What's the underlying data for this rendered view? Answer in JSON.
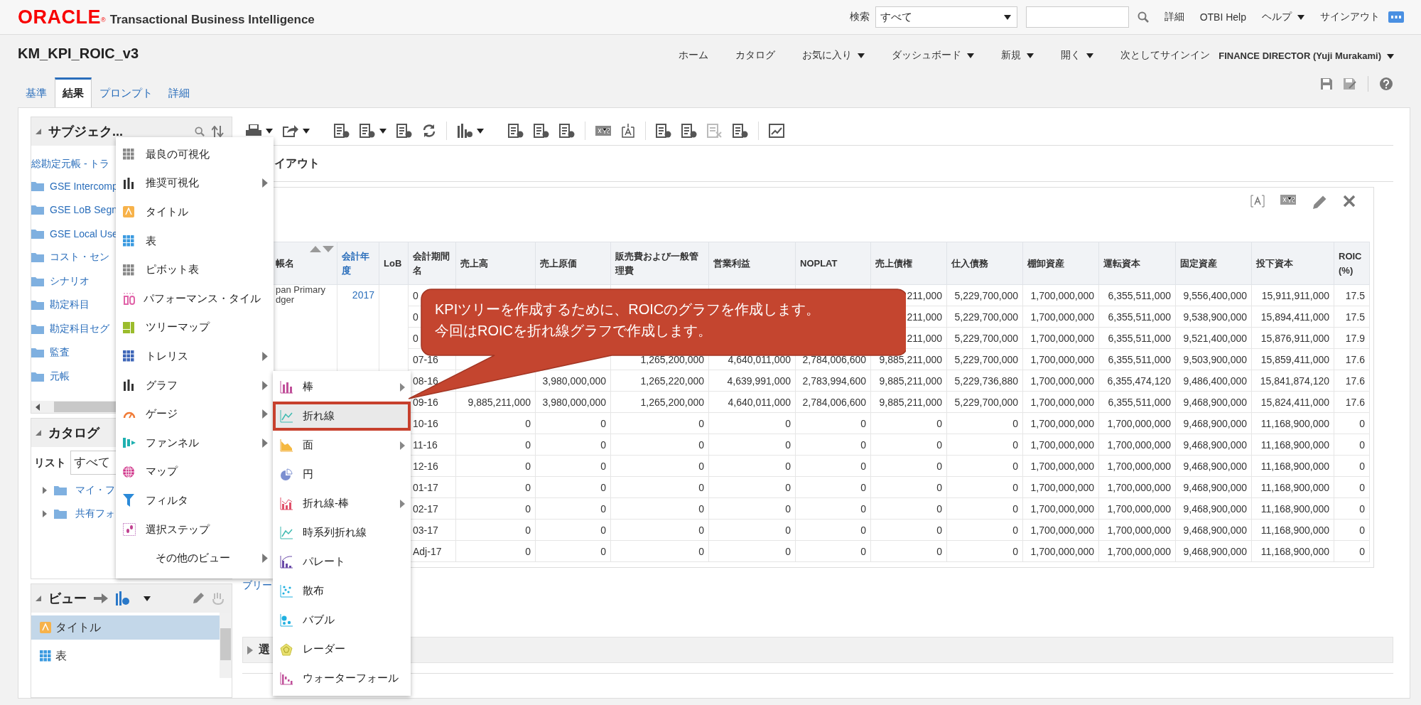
{
  "header": {
    "brand": "ORACLE",
    "brand_mark": "®",
    "product": "Transactional Business Intelligence",
    "search_label": "検索",
    "search_scope": "すべて",
    "links": [
      {
        "label": "詳細",
        "dropdown": false
      },
      {
        "label": "OTBI Help",
        "dropdown": false
      },
      {
        "label": "ヘルプ",
        "dropdown": true
      },
      {
        "label": "サインアウト",
        "dropdown": false
      }
    ]
  },
  "title": "KM_KPI_ROIC_v3",
  "nav": [
    {
      "label": "ホーム",
      "dropdown": false
    },
    {
      "label": "カタログ",
      "dropdown": false
    },
    {
      "label": "お気に入り",
      "dropdown": true
    },
    {
      "label": "ダッシュボード",
      "dropdown": true
    },
    {
      "label": "新規",
      "dropdown": true
    },
    {
      "label": "開く",
      "dropdown": true
    }
  ],
  "signed_in": {
    "label": "次としてサインイン",
    "user": "FINANCE DIRECTOR (Yuji Murakami)"
  },
  "tabs": [
    {
      "label": "基準",
      "selected": false
    },
    {
      "label": "結果",
      "selected": true
    },
    {
      "label": "プロンプト",
      "selected": false
    },
    {
      "label": "詳細",
      "selected": false
    }
  ],
  "subject_areas": {
    "title": "サブジェク...",
    "root": "総勘定元帳 - トラ",
    "folders": [
      "GSE Intercomp",
      "GSE LoB Segn",
      "GSE Local Use",
      "コスト・セン",
      "シナリオ",
      "勘定科目",
      "勘定科目セグ",
      "監査",
      "元帳"
    ]
  },
  "catalog": {
    "title": "カタログ",
    "list_label": "リスト",
    "list_value": "すべて",
    "folders": [
      {
        "label": "マイ・フ",
        "expanded": false
      },
      {
        "label": "共有フォ",
        "expanded": false
      }
    ]
  },
  "views": {
    "title": "ビュー",
    "items": [
      {
        "label": "タイトル",
        "selected": true
      },
      {
        "label": "表",
        "selected": false
      }
    ]
  },
  "layout_title": "イアウト",
  "table": {
    "columns": [
      {
        "label": "帳名",
        "link": false,
        "sortable": true
      },
      {
        "label": "会計年度",
        "link": true,
        "sortable": false
      },
      {
        "label": "LoB",
        "link": false,
        "sortable": false
      },
      {
        "label": "会計期間名",
        "link": false,
        "sortable": false
      },
      {
        "label": "売上高",
        "link": false,
        "sortable": false
      },
      {
        "label": "売上原価",
        "link": false,
        "sortable": false
      },
      {
        "label": "販売費および一般管理費",
        "link": false,
        "sortable": false
      },
      {
        "label": "営業利益",
        "link": false,
        "sortable": false
      },
      {
        "label": "NOPLAT",
        "link": false,
        "sortable": false
      },
      {
        "label": "売上債権",
        "link": false,
        "sortable": false
      },
      {
        "label": "仕入債務",
        "link": false,
        "sortable": false
      },
      {
        "label": "棚卸資産",
        "link": false,
        "sortable": false
      },
      {
        "label": "運転資本",
        "link": false,
        "sortable": false
      },
      {
        "label": "固定資産",
        "link": false,
        "sortable": false
      },
      {
        "label": "投下資本",
        "link": false,
        "sortable": false
      },
      {
        "label": "ROIC (%)",
        "link": false,
        "sortable": false
      }
    ],
    "rows": [
      [
        "pan Primary dger",
        "2017",
        "",
        "0",
        null,
        null,
        null,
        null,
        null,
        "211,000",
        "5,229,700,000",
        "1,700,000,000",
        "6,355,511,000",
        "9,556,400,000",
        "15,911,911,000",
        "17.5"
      ],
      [
        null,
        null,
        null,
        "0",
        null,
        null,
        null,
        null,
        null,
        "211,000",
        "5,229,700,000",
        "1,700,000,000",
        "6,355,511,000",
        "9,538,900,000",
        "15,894,411,000",
        "17.5"
      ],
      [
        null,
        null,
        null,
        "0",
        null,
        null,
        null,
        null,
        null,
        "211,000",
        "5,229,700,000",
        "1,700,000,000",
        "6,355,511,000",
        "9,521,400,000",
        "15,876,911,000",
        "17.9"
      ],
      [
        null,
        null,
        null,
        "07-16",
        null,
        null,
        "1,265,200,000",
        "4,640,011,000",
        "2,784,006,600",
        "9,885,211,000",
        "5,229,700,000",
        "1,700,000,000",
        "6,355,511,000",
        "9,503,900,000",
        "15,859,411,000",
        "17.6"
      ],
      [
        null,
        null,
        null,
        "08-16",
        null,
        "3,980,000,000",
        "1,265,220,000",
        "4,639,991,000",
        "2,783,994,600",
        "9,885,211,000",
        "5,229,736,880",
        "1,700,000,000",
        "6,355,474,120",
        "9,486,400,000",
        "15,841,874,120",
        "17.6"
      ],
      [
        null,
        null,
        null,
        "09-16",
        "9,885,211,000",
        "3,980,000,000",
        "1,265,200,000",
        "4,640,011,000",
        "2,784,006,600",
        "9,885,211,000",
        "5,229,700,000",
        "1,700,000,000",
        "6,355,511,000",
        "9,468,900,000",
        "15,824,411,000",
        "17.6"
      ],
      [
        null,
        null,
        null,
        "10-16",
        "0",
        "0",
        "0",
        "0",
        "0",
        "0",
        "0",
        "1,700,000,000",
        "1,700,000,000",
        "9,468,900,000",
        "11,168,900,000",
        "0"
      ],
      [
        null,
        null,
        null,
        "11-16",
        "0",
        "0",
        "0",
        "0",
        "0",
        "0",
        "0",
        "1,700,000,000",
        "1,700,000,000",
        "9,468,900,000",
        "11,168,900,000",
        "0"
      ],
      [
        null,
        null,
        null,
        "12-16",
        "0",
        "0",
        "0",
        "0",
        "0",
        "0",
        "0",
        "1,700,000,000",
        "1,700,000,000",
        "9,468,900,000",
        "11,168,900,000",
        "0"
      ],
      [
        null,
        null,
        null,
        "01-17",
        "0",
        "0",
        "0",
        "0",
        "0",
        "0",
        "0",
        "1,700,000,000",
        "1,700,000,000",
        "9,468,900,000",
        "11,168,900,000",
        "0"
      ],
      [
        null,
        null,
        null,
        "02-17",
        "0",
        "0",
        "0",
        "0",
        "0",
        "0",
        "0",
        "1,700,000,000",
        "1,700,000,000",
        "9,468,900,000",
        "11,168,900,000",
        "0"
      ],
      [
        null,
        null,
        null,
        "03-17",
        "0",
        "0",
        "0",
        "0",
        "0",
        "0",
        "0",
        "1,700,000,000",
        "1,700,000,000",
        "9,468,900,000",
        "11,168,900,000",
        "0"
      ],
      [
        null,
        null,
        null,
        "Adj-17",
        "0",
        "0",
        "0",
        "0",
        "0",
        "0",
        "0",
        "1,700,000,000",
        "1,700,000,000",
        "9,468,900,000",
        "11,168,900,000",
        "0"
      ]
    ]
  },
  "link_below": "ブリー",
  "section_title": "選",
  "menu": [
    {
      "label": "最良の可視化",
      "has_submenu": false
    },
    {
      "label": "推奨可視化",
      "has_submenu": true
    },
    {
      "label": "タイトル",
      "has_submenu": false
    },
    {
      "label": "表",
      "has_submenu": false
    },
    {
      "label": "ピボット表",
      "has_submenu": false
    },
    {
      "label": "パフォーマンス・タイル",
      "has_submenu": false
    },
    {
      "label": "ツリーマップ",
      "has_submenu": false
    },
    {
      "label": "トレリス",
      "has_submenu": true
    },
    {
      "label": "グラフ",
      "has_submenu": true
    },
    {
      "label": "ゲージ",
      "has_submenu": true
    },
    {
      "label": "ファンネル",
      "has_submenu": true
    },
    {
      "label": "マップ",
      "has_submenu": false
    },
    {
      "label": "フィルタ",
      "has_submenu": false
    },
    {
      "label": "選択ステップ",
      "has_submenu": false
    },
    {
      "label": "その他のビュー",
      "has_submenu": true
    }
  ],
  "submenu": [
    {
      "label": "棒",
      "has_submenu": true,
      "selected": false
    },
    {
      "label": "折れ線",
      "has_submenu": false,
      "selected": true
    },
    {
      "label": "面",
      "has_submenu": true,
      "selected": false
    },
    {
      "label": "円",
      "has_submenu": false,
      "selected": false
    },
    {
      "label": "折れ線-棒",
      "has_submenu": true,
      "selected": false
    },
    {
      "label": "時系列折れ線",
      "has_submenu": false,
      "selected": false
    },
    {
      "label": "パレート",
      "has_submenu": false,
      "selected": false
    },
    {
      "label": "散布",
      "has_submenu": false,
      "selected": false
    },
    {
      "label": "バブル",
      "has_submenu": false,
      "selected": false
    },
    {
      "label": "レーダー",
      "has_submenu": false,
      "selected": false
    },
    {
      "label": "ウォーターフォール",
      "has_submenu": false,
      "selected": false
    }
  ],
  "callout": {
    "lines": [
      "KPIツリーを作成するために、ROICのグラフを作成します。",
      "今回はROICを折れ線グラフで作成します。"
    ]
  }
}
